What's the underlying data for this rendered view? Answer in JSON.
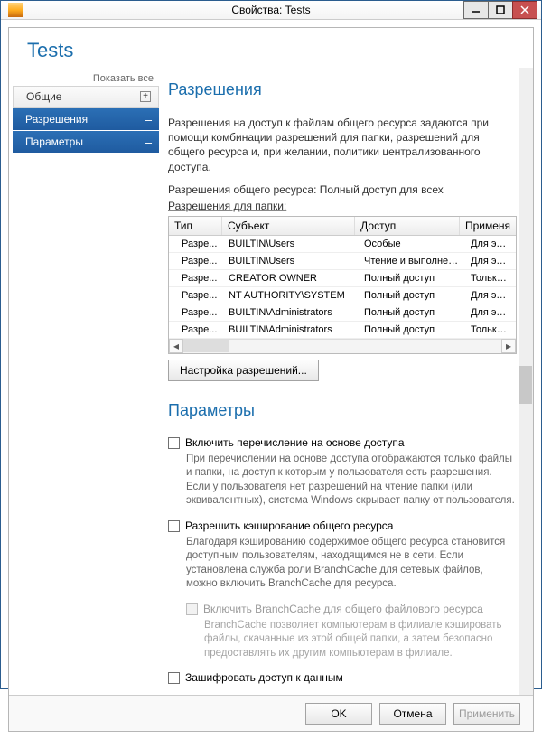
{
  "titlebar": {
    "title": "Свойства: Tests"
  },
  "page_title": "Tests",
  "nav": {
    "show_all": "Показать все",
    "items": [
      {
        "label": "Общие",
        "glyph": "+",
        "style": "plain"
      },
      {
        "label": "Разрешения",
        "glyph": "–",
        "style": "sel"
      },
      {
        "label": "Параметры",
        "glyph": "–",
        "style": "sel2"
      }
    ]
  },
  "perm": {
    "title": "Разрешения",
    "intro": "Разрешения на доступ к файлам общего ресурса задаются при помощи комбинации разрешений для папки, разрешений для общего ресурса и, при желании, политики централизованного доступа.",
    "share_line_label": "Разрешения общего ресурса:",
    "share_line_value": "Полный доступ для всех",
    "folder_label": "Разрешения для папки:",
    "columns": {
      "type": "Тип",
      "subject": "Субъект",
      "access": "Доступ",
      "applies": "Применя"
    },
    "rows": [
      {
        "type": "Разре...",
        "subject": "BUILTIN\\Users",
        "access": "Особые",
        "applies": "Для этой"
      },
      {
        "type": "Разре...",
        "subject": "BUILTIN\\Users",
        "access": "Чтение и выполнен...",
        "applies": "Для этой"
      },
      {
        "type": "Разре...",
        "subject": "CREATOR OWNER",
        "access": "Полный доступ",
        "applies": "Только д"
      },
      {
        "type": "Разре...",
        "subject": "NT AUTHORITY\\SYSTEM",
        "access": "Полный доступ",
        "applies": "Для этой"
      },
      {
        "type": "Разре...",
        "subject": "BUILTIN\\Administrators",
        "access": "Полный доступ",
        "applies": "Для этой"
      },
      {
        "type": "Разре...",
        "subject": "BUILTIN\\Administrators",
        "access": "Полный доступ",
        "applies": "Только д"
      }
    ],
    "config_button": "Настройка разрешений..."
  },
  "params": {
    "title": "Параметры",
    "abe_label": "Включить перечисление на основе доступа",
    "abe_help": "При перечислении на основе доступа отображаются только файлы и папки, на доступ к которым у пользователя есть разрешения. Если у пользователя нет разрешений на чтение папки (или эквивалентных), система Windows скрывает папку от пользователя.",
    "cache_label": "Разрешить кэширование общего ресурса",
    "cache_help": "Благодаря кэшированию содержимое общего ресурса становится доступным пользователям, находящимся не в сети. Если установлена служба роли BranchCache для сетевых файлов, можно включить BranchCache для ресурса.",
    "bc_label": "Включить BranchCache для общего файлового ресурса",
    "bc_help": "BranchCache позволяет компьютерам в филиале кэшировать файлы, скачанные из этой общей папки, а затем безопасно предоставлять их другим компьютерам в филиале.",
    "encrypt_label": "Зашифровать доступ к данным"
  },
  "footer": {
    "ok": "OK",
    "cancel": "Отмена",
    "apply": "Применить"
  }
}
